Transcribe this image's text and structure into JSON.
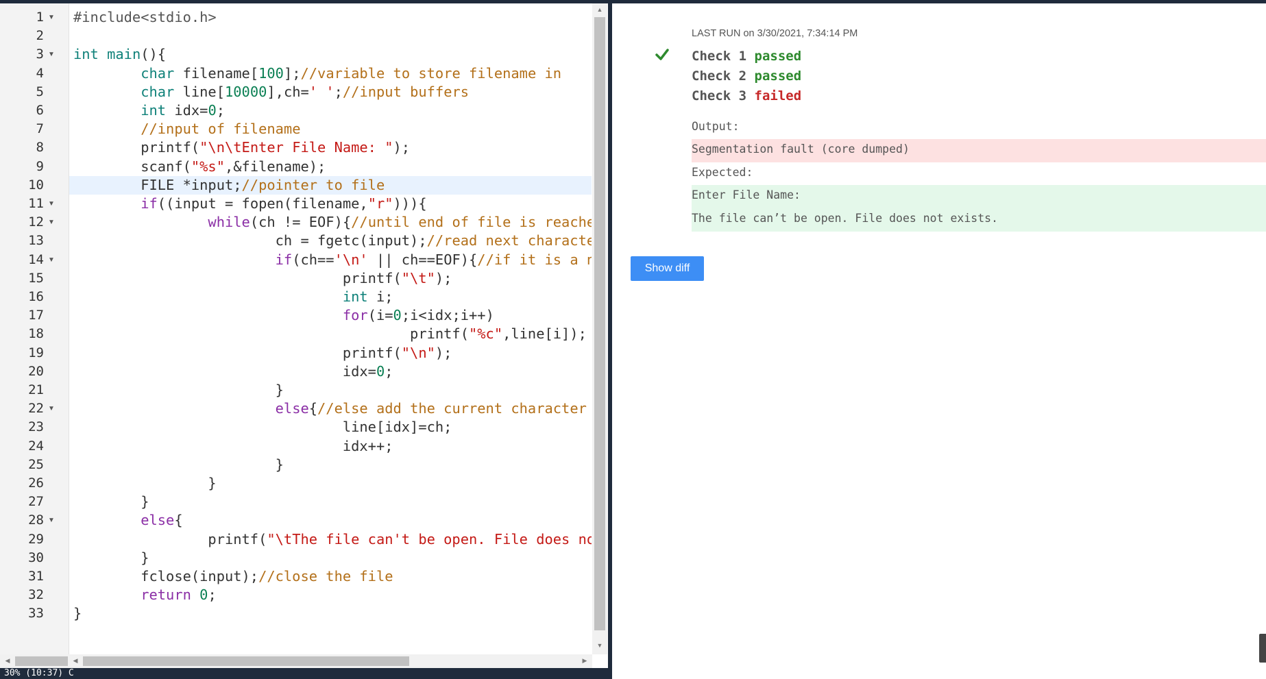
{
  "editor": {
    "lines": [
      {
        "num": "1",
        "fold": true,
        "tokens": [
          {
            "t": "#include<stdio.h>",
            "c": "d"
          }
        ]
      },
      {
        "num": "2",
        "fold": false,
        "tokens": []
      },
      {
        "num": "3",
        "fold": true,
        "tokens": [
          {
            "t": "int",
            "c": "t"
          },
          {
            "t": " "
          },
          {
            "t": "main",
            "c": "t"
          },
          {
            "t": "(){"
          }
        ]
      },
      {
        "num": "4",
        "fold": false,
        "tokens": [
          {
            "t": "        "
          },
          {
            "t": "char",
            "c": "t"
          },
          {
            "t": " filename["
          },
          {
            "t": "100",
            "c": "n"
          },
          {
            "t": "];"
          },
          {
            "t": "//variable to store filename in",
            "c": "c"
          }
        ]
      },
      {
        "num": "5",
        "fold": false,
        "tokens": [
          {
            "t": "        "
          },
          {
            "t": "char",
            "c": "t"
          },
          {
            "t": " line["
          },
          {
            "t": "10000",
            "c": "n"
          },
          {
            "t": "],ch="
          },
          {
            "t": "' '",
            "c": "s"
          },
          {
            "t": ";"
          },
          {
            "t": "//input buffers",
            "c": "c"
          }
        ]
      },
      {
        "num": "6",
        "fold": false,
        "tokens": [
          {
            "t": "        "
          },
          {
            "t": "int",
            "c": "t"
          },
          {
            "t": " idx="
          },
          {
            "t": "0",
            "c": "n"
          },
          {
            "t": ";"
          }
        ]
      },
      {
        "num": "7",
        "fold": false,
        "tokens": [
          {
            "t": "        "
          },
          {
            "t": "//input of filename",
            "c": "c"
          }
        ]
      },
      {
        "num": "8",
        "fold": false,
        "tokens": [
          {
            "t": "        printf("
          },
          {
            "t": "\"\\n\\tEnter File Name: \"",
            "c": "s"
          },
          {
            "t": ");"
          }
        ]
      },
      {
        "num": "9",
        "fold": false,
        "tokens": [
          {
            "t": "        scanf("
          },
          {
            "t": "\"%s\"",
            "c": "s"
          },
          {
            "t": ",&filename);"
          }
        ]
      },
      {
        "num": "10",
        "fold": false,
        "active": true,
        "tokens": [
          {
            "t": "        FILE *input;"
          },
          {
            "t": "//pointer to file",
            "c": "c"
          }
        ]
      },
      {
        "num": "11",
        "fold": true,
        "tokens": [
          {
            "t": "        "
          },
          {
            "t": "if",
            "c": "k"
          },
          {
            "t": "((input = fopen(filename,"
          },
          {
            "t": "\"r\"",
            "c": "s"
          },
          {
            "t": "))){"
          }
        ]
      },
      {
        "num": "12",
        "fold": true,
        "tokens": [
          {
            "t": "                "
          },
          {
            "t": "while",
            "c": "k"
          },
          {
            "t": "(ch != EOF){"
          },
          {
            "t": "//until end of file is reache",
            "c": "c"
          }
        ]
      },
      {
        "num": "13",
        "fold": false,
        "tokens": [
          {
            "t": "                        ch = fgetc(input);"
          },
          {
            "t": "//read next characte",
            "c": "c"
          }
        ]
      },
      {
        "num": "14",
        "fold": true,
        "tokens": [
          {
            "t": "                        "
          },
          {
            "t": "if",
            "c": "k"
          },
          {
            "t": "(ch=="
          },
          {
            "t": "'\\n'",
            "c": "s"
          },
          {
            "t": " || ch==EOF){"
          },
          {
            "t": "//if it is a n",
            "c": "c"
          }
        ]
      },
      {
        "num": "15",
        "fold": false,
        "tokens": [
          {
            "t": "                                printf("
          },
          {
            "t": "\"\\t\"",
            "c": "s"
          },
          {
            "t": ");"
          }
        ]
      },
      {
        "num": "16",
        "fold": false,
        "tokens": [
          {
            "t": "                                "
          },
          {
            "t": "int",
            "c": "t"
          },
          {
            "t": " i;"
          }
        ]
      },
      {
        "num": "17",
        "fold": false,
        "tokens": [
          {
            "t": "                                "
          },
          {
            "t": "for",
            "c": "k"
          },
          {
            "t": "(i="
          },
          {
            "t": "0",
            "c": "n"
          },
          {
            "t": ";i<idx;i++)"
          }
        ]
      },
      {
        "num": "18",
        "fold": false,
        "tokens": [
          {
            "t": "                                        printf("
          },
          {
            "t": "\"%c\"",
            "c": "s"
          },
          {
            "t": ",line[i]);"
          }
        ]
      },
      {
        "num": "19",
        "fold": false,
        "tokens": [
          {
            "t": "                                printf("
          },
          {
            "t": "\"\\n\"",
            "c": "s"
          },
          {
            "t": ");"
          }
        ]
      },
      {
        "num": "20",
        "fold": false,
        "tokens": [
          {
            "t": "                                idx="
          },
          {
            "t": "0",
            "c": "n"
          },
          {
            "t": ";"
          }
        ]
      },
      {
        "num": "21",
        "fold": false,
        "tokens": [
          {
            "t": "                        }"
          }
        ]
      },
      {
        "num": "22",
        "fold": true,
        "tokens": [
          {
            "t": "                        "
          },
          {
            "t": "else",
            "c": "k"
          },
          {
            "t": "{"
          },
          {
            "t": "//else add the current character",
            "c": "c"
          }
        ]
      },
      {
        "num": "23",
        "fold": false,
        "tokens": [
          {
            "t": "                                line[idx]=ch;"
          }
        ]
      },
      {
        "num": "24",
        "fold": false,
        "tokens": [
          {
            "t": "                                idx++;"
          }
        ]
      },
      {
        "num": "25",
        "fold": false,
        "tokens": [
          {
            "t": "                        }"
          }
        ]
      },
      {
        "num": "26",
        "fold": false,
        "tokens": [
          {
            "t": "                }"
          }
        ]
      },
      {
        "num": "27",
        "fold": false,
        "tokens": [
          {
            "t": "        }"
          }
        ]
      },
      {
        "num": "28",
        "fold": true,
        "tokens": [
          {
            "t": "        "
          },
          {
            "t": "else",
            "c": "k"
          },
          {
            "t": "{"
          }
        ]
      },
      {
        "num": "29",
        "fold": false,
        "tokens": [
          {
            "t": "                printf("
          },
          {
            "t": "\"\\tThe file can't be open. File does no",
            "c": "s"
          }
        ]
      },
      {
        "num": "30",
        "fold": false,
        "tokens": [
          {
            "t": "        }"
          }
        ]
      },
      {
        "num": "31",
        "fold": false,
        "tokens": [
          {
            "t": "        fclose(input);"
          },
          {
            "t": "//close the file",
            "c": "c"
          }
        ]
      },
      {
        "num": "32",
        "fold": false,
        "tokens": [
          {
            "t": "        "
          },
          {
            "t": "return",
            "c": "k"
          },
          {
            "t": " "
          },
          {
            "t": "0",
            "c": "n"
          },
          {
            "t": ";"
          }
        ]
      },
      {
        "num": "33",
        "fold": false,
        "tokens": [
          {
            "t": "}"
          }
        ]
      }
    ],
    "status_text": "30%  (10:37)                                          C"
  },
  "results": {
    "last_run": "LAST RUN on 3/30/2021, 7:34:14 PM",
    "checks": [
      {
        "label": "Check 1",
        "status": "passed"
      },
      {
        "label": "Check 2",
        "status": "passed"
      },
      {
        "label": "Check 3",
        "status": "failed"
      }
    ],
    "output_label": "Output:",
    "output_value": "Segmentation fault (core dumped)",
    "expected_label": "Expected:",
    "expected_lines": [
      "Enter File Name:",
      "The file can’t be open. File does not exists."
    ],
    "show_diff_label": "Show diff"
  },
  "colors": {
    "passed": "#2e8a2e",
    "failed": "#c62828",
    "output_bg": "#fde1e1",
    "expected_bg": "#e4f8ea",
    "button": "#3d8ef5",
    "dark_bar": "#1f2b3c"
  },
  "icons": {
    "check": "check-icon",
    "fold": "fold-arrow-icon"
  }
}
